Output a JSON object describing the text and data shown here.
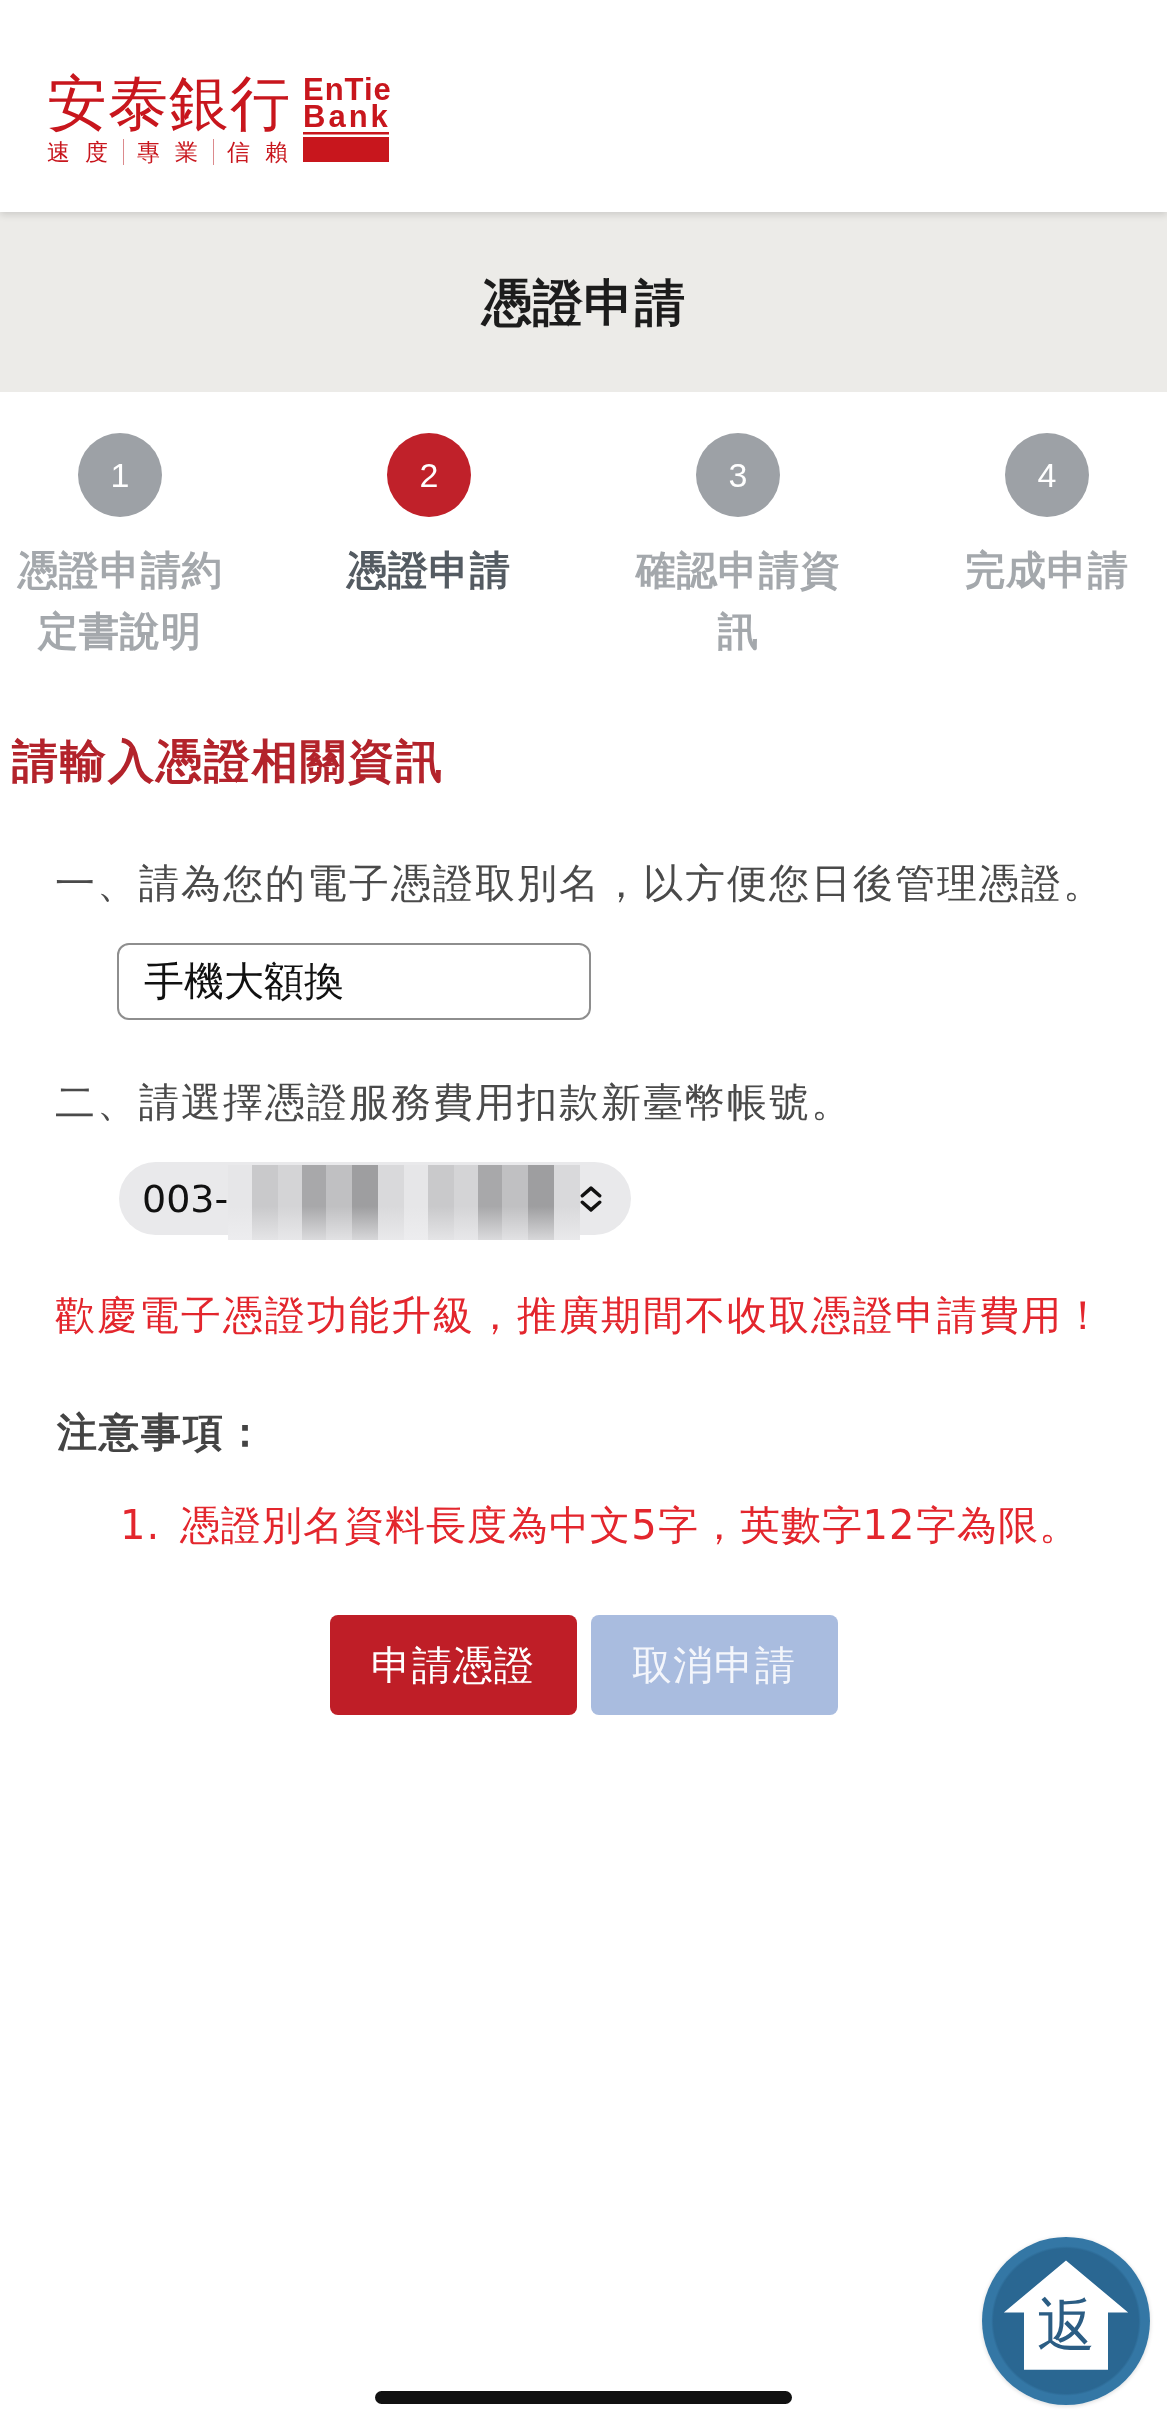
{
  "header": {
    "logo": {
      "name": "安泰銀行",
      "tagline": [
        "速度",
        "專業",
        "信賴"
      ],
      "english": [
        "EnTie",
        "Bank"
      ]
    }
  },
  "title": "憑證申請",
  "steps": [
    {
      "number": "1",
      "label": "憑證申請約定書說明",
      "selected": false
    },
    {
      "number": "2",
      "label": "憑證申請",
      "selected": true
    },
    {
      "number": "3",
      "label": "確認申請資訊",
      "selected": false
    },
    {
      "number": "4",
      "label": "完成申請",
      "selected": false
    }
  ],
  "form": {
    "heading": "請輸入憑證相關資訊",
    "fields": [
      {
        "kind": "text",
        "label": "一、請為您的電子憑證取別名，以方便您日後管理憑證。",
        "value": "手機大額換"
      },
      {
        "kind": "select",
        "label": "二、請選擇憑證服務費用扣款新臺幣帳號。",
        "value": "003-"
      }
    ]
  },
  "promo": "歡慶電子憑證功能升級，推廣期間不收取憑證申請費用！",
  "notes": {
    "title": "注意事項：",
    "items": [
      {
        "number": "1.",
        "text": "憑證別名資料長度為中文5字，英數字12字為限。"
      }
    ]
  },
  "buttons": [
    {
      "label": "申請憑證",
      "kind": "primary"
    },
    {
      "label": "取消申請",
      "kind": "secondary"
    }
  ],
  "home_button": {
    "label": "返"
  }
}
